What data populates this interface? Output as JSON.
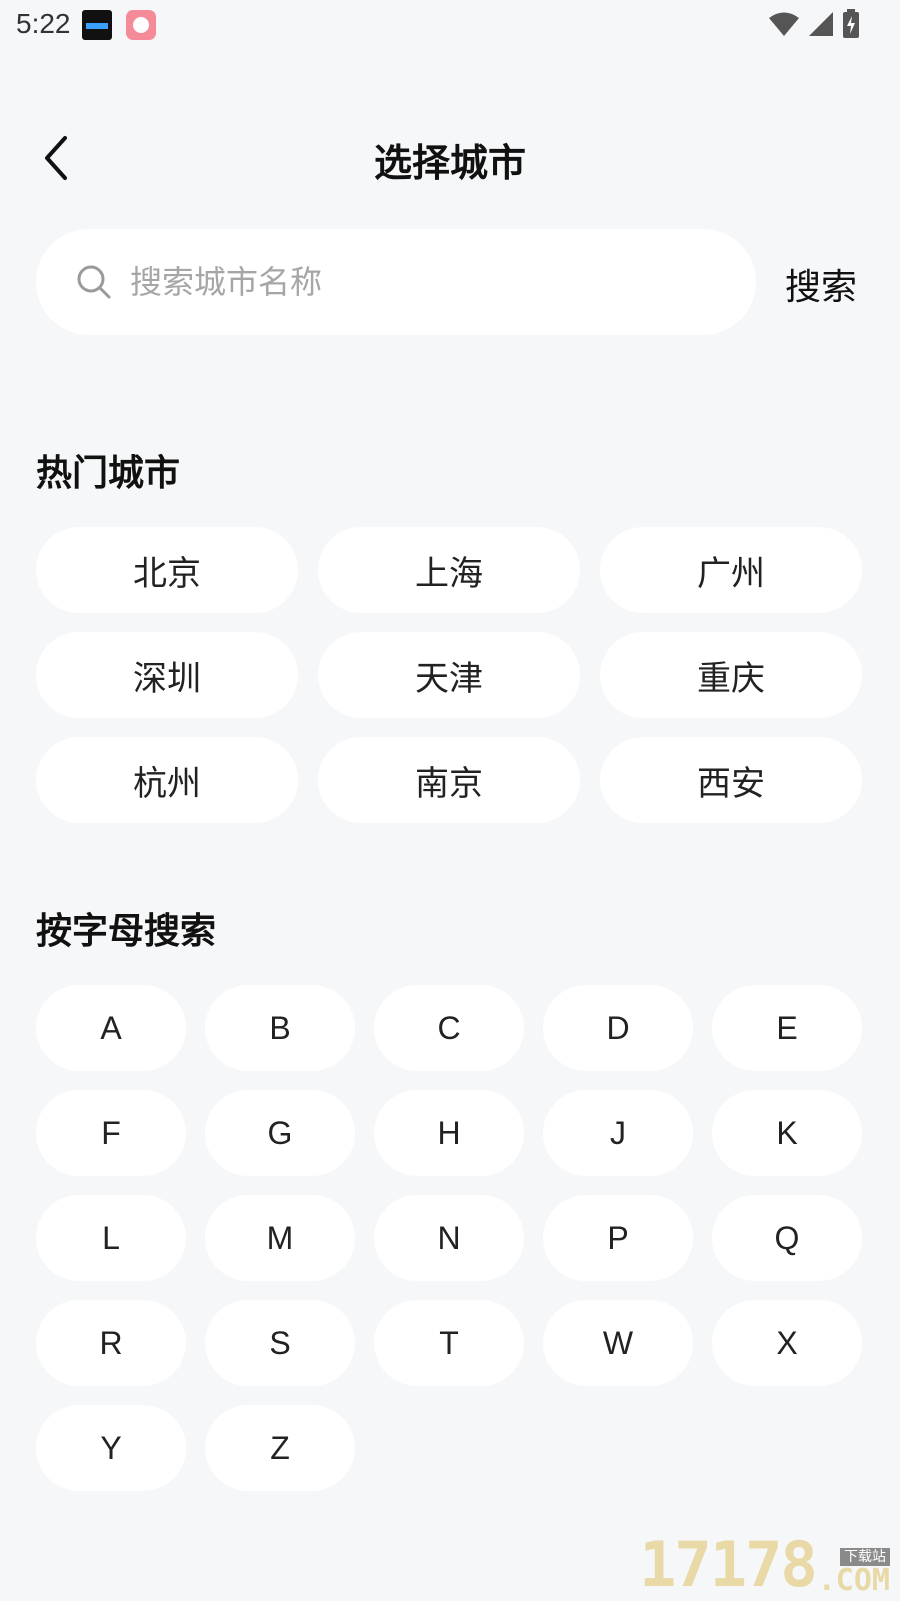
{
  "status_bar": {
    "time": "5:22",
    "icons": [
      "clock-app-icon",
      "rice-app-icon",
      "wifi-icon",
      "signal-icon",
      "battery-charging-icon"
    ]
  },
  "header": {
    "title": "选择城市",
    "back_icon": "chevron-left-icon"
  },
  "search": {
    "placeholder": "搜索城市名称",
    "value": "",
    "button_label": "搜索"
  },
  "hot_cities": {
    "title": "热门城市",
    "items": [
      "北京",
      "上海",
      "广州",
      "深圳",
      "天津",
      "重庆",
      "杭州",
      "南京",
      "西安"
    ]
  },
  "alphabet": {
    "title": "按字母搜索",
    "letters": [
      "A",
      "B",
      "C",
      "D",
      "E",
      "F",
      "G",
      "H",
      "J",
      "K",
      "L",
      "M",
      "N",
      "P",
      "Q",
      "R",
      "S",
      "T",
      "W",
      "X",
      "Y",
      "Z"
    ]
  },
  "watermark": {
    "number": "17178",
    "tag": "下载站",
    "suffix": ".COM"
  },
  "colors": {
    "background": "#f6f7f9",
    "chip": "#ffffff",
    "text": "#111111",
    "placeholder": "#a6a6a6"
  }
}
